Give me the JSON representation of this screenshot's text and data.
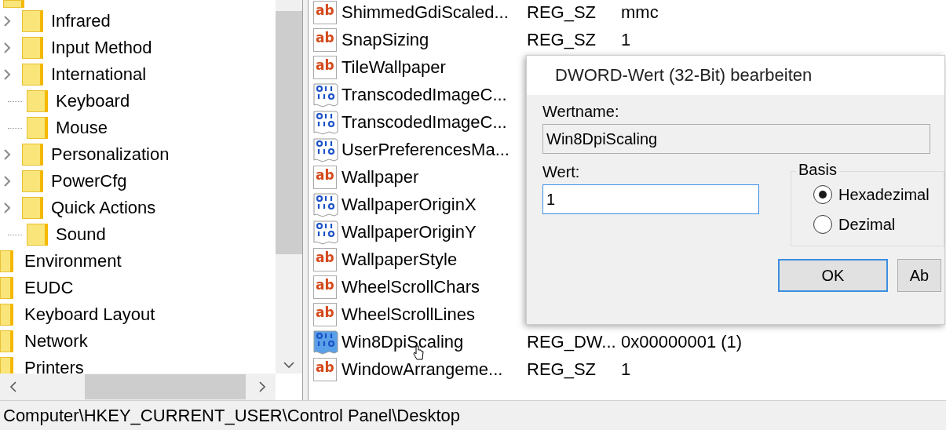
{
  "tree": {
    "items": [
      {
        "children": [
          {
            "label": "Infrared",
            "expandable": true
          },
          {
            "label": "Input Method",
            "expandable": true
          },
          {
            "label": "International",
            "expandable": true
          },
          {
            "label": "Keyboard",
            "expandable": false
          },
          {
            "label": "Mouse",
            "expandable": false
          },
          {
            "label": "Personalization",
            "expandable": true
          },
          {
            "label": "PowerCfg",
            "expandable": true
          },
          {
            "label": "Quick Actions",
            "expandable": true
          },
          {
            "label": "Sound",
            "expandable": false
          }
        ]
      },
      {
        "label": "Environment"
      },
      {
        "label": "EUDC"
      },
      {
        "label": "Keyboard Layout"
      },
      {
        "label": "Network"
      },
      {
        "label": "Printers"
      }
    ]
  },
  "values": [
    {
      "kind": "string",
      "icon_label": "ab",
      "name": "ShimmedGdiScaled...",
      "type": "REG_SZ",
      "data": "mmc",
      "selected": false
    },
    {
      "kind": "string",
      "icon_label": "ab",
      "name": "SnapSizing",
      "type": "REG_SZ",
      "data": "1",
      "selected": false
    },
    {
      "kind": "string",
      "icon_label": "ab",
      "name": "TileWallpaper",
      "selected": false
    },
    {
      "kind": "binary",
      "name": "TranscodedImageC...",
      "selected": false
    },
    {
      "kind": "binary",
      "name": "TranscodedImageC...",
      "selected": false
    },
    {
      "kind": "binary",
      "name": "UserPreferencesMa...",
      "selected": false
    },
    {
      "kind": "string",
      "icon_label": "ab",
      "name": "Wallpaper",
      "selected": false
    },
    {
      "kind": "binary",
      "name": "WallpaperOriginX",
      "selected": false
    },
    {
      "kind": "binary",
      "name": "WallpaperOriginY",
      "selected": false
    },
    {
      "kind": "string",
      "icon_label": "ab",
      "name": "WallpaperStyle",
      "selected": false
    },
    {
      "kind": "string",
      "icon_label": "ab",
      "name": "WheelScrollChars",
      "selected": false
    },
    {
      "kind": "string",
      "icon_label": "ab",
      "name": "WheelScrollLines",
      "selected": false
    },
    {
      "kind": "binary",
      "name": "Win8DpiScaling",
      "type": "REG_DW...",
      "data": "0x00000001 (1)",
      "selected": true
    },
    {
      "kind": "string",
      "icon_label": "ab",
      "name": "WindowArrangeme...",
      "type": "REG_SZ",
      "data": "1",
      "selected": false
    }
  ],
  "status_bar": "Computer\\HKEY_CURRENT_USER\\Control Panel\\Desktop",
  "dialog": {
    "title": "DWORD-Wert (32-Bit) bearbeiten",
    "name_label": "Wertname:",
    "name_value": "Win8DpiScaling",
    "value_label": "Wert:",
    "value": "1",
    "base_label": "Basis",
    "bases": [
      {
        "label": "Hexadezimal",
        "selected": true
      },
      {
        "label": "Dezimal",
        "selected": false
      }
    ],
    "buttons": [
      "OK",
      "Ab"
    ]
  }
}
